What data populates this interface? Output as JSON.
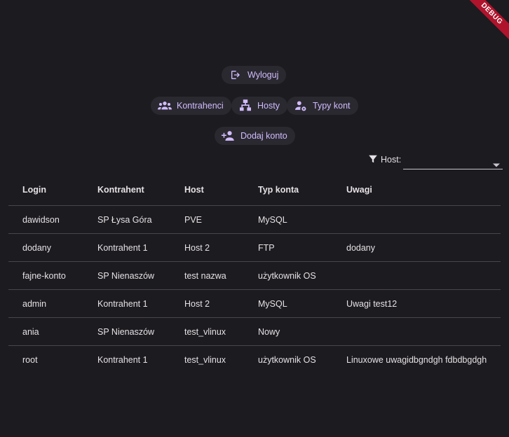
{
  "debug_badge": "DEBUG",
  "toolbar": {
    "logout_label": "Wyloguj",
    "contractors_label": "Kontrahenci",
    "hosts_label": "Hosty",
    "account_types_label": "Typy kont",
    "add_account_label": "Dodaj konto"
  },
  "filter": {
    "label": "Host:",
    "selected": ""
  },
  "table": {
    "headers": [
      "Login",
      "Kontrahent",
      "Host",
      "Typ konta",
      "Uwagi"
    ],
    "rows": [
      [
        "dawidson",
        "SP Łysa Góra",
        "PVE",
        "MySQL",
        ""
      ],
      [
        "dodany",
        "Kontrahent 1",
        "Host 2",
        "FTP",
        "dodany"
      ],
      [
        "fajne-konto",
        "SP Nienaszów",
        "test nazwa",
        "użytkownik OS",
        ""
      ],
      [
        "admin",
        "Kontrahent 1",
        "Host 2",
        "MySQL",
        "Uwagi test12"
      ],
      [
        "ania",
        "SP Nienaszów",
        "test_vlinux",
        "Nowy",
        ""
      ],
      [
        "root",
        "Kontrahent 1",
        "test_vlinux",
        "użytkownik OS",
        "Linuxowe uwagidbgndgh  fdbdbgdgh"
      ]
    ]
  },
  "colors": {
    "background": "#1c1b1f",
    "button_bg": "#2b2930",
    "accent": "#d0bcff",
    "divider": "#49454f",
    "debug_ribbon": "#b0142c"
  },
  "icons": {
    "logout": "logout-icon",
    "contractors": "groups-icon",
    "hosts": "account-tree-icon",
    "account_types": "manage-accounts-icon",
    "add_account": "person-add-icon",
    "filter": "filter-icon",
    "dropdown": "arrow-drop-down-icon"
  }
}
